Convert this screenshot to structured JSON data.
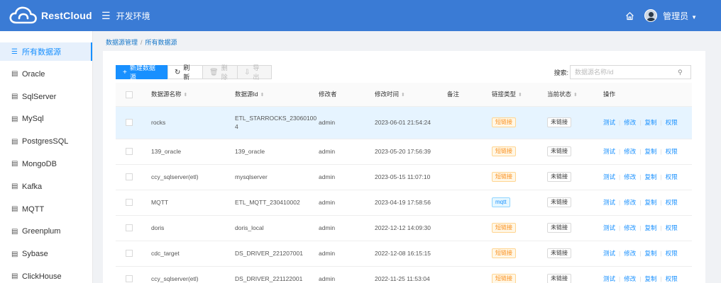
{
  "app": {
    "brand": "RestCloud",
    "environment": "开发环境",
    "user": "管理员"
  },
  "icons": {
    "menu": "menu-icon",
    "home": "home-icon",
    "list": "list-icon",
    "database": "database-icon",
    "search": "search-icon",
    "refresh": "refresh-icon",
    "delete": "trash-icon",
    "export": "export-icon",
    "add": "plus-icon"
  },
  "colors": {
    "header": "#3a7bd5",
    "primary": "#1890ff",
    "tag_short": "#fa8c16",
    "tag_mqtt": "#1890ff"
  },
  "sidebar": {
    "items": [
      {
        "label": "所有数据源",
        "active": true
      },
      {
        "label": "Oracle"
      },
      {
        "label": "SqlServer"
      },
      {
        "label": "MySql"
      },
      {
        "label": "PostgresSQL"
      },
      {
        "label": "MongoDB"
      },
      {
        "label": "Kafka"
      },
      {
        "label": "MQTT"
      },
      {
        "label": "Greenplum"
      },
      {
        "label": "Sybase"
      },
      {
        "label": "ClickHouse"
      }
    ]
  },
  "breadcrumb": {
    "parent": "数据源管理",
    "separator": "/",
    "current": "所有数据源"
  },
  "toolbar": {
    "new": "新建数据源",
    "refresh": "刷新",
    "delete": "删除",
    "export": "导出"
  },
  "search": {
    "label": "搜索:",
    "placeholder": "数据源名称/id"
  },
  "table": {
    "headers": {
      "name": "数据源名称",
      "id": "数据源Id",
      "modifier": "修改者",
      "time": "修改时间",
      "note": "备注",
      "link_type": "链接类型",
      "status": "当前状态",
      "ops": "操作"
    },
    "actions": [
      "测试",
      "修改",
      "复制",
      "权限"
    ],
    "rows": [
      {
        "name": "rocks",
        "id": "ETL_STARROCKS_23060100\n4",
        "modifier": "admin",
        "time": "2023-06-01 21:54:24",
        "note": "",
        "link_type": "短链接",
        "status": "未链接"
      },
      {
        "name": "139_oracle",
        "id": "139_oracle",
        "modifier": "admin",
        "time": "2023-05-20 17:56:39",
        "note": "",
        "link_type": "短链接",
        "status": "未链接"
      },
      {
        "name": "ccy_sqlserver(etl)",
        "id": "mysqlserver",
        "modifier": "admin",
        "time": "2023-05-15 11:07:10",
        "note": "",
        "link_type": "短链接",
        "status": "未链接"
      },
      {
        "name": "MQTT",
        "id": "ETL_MQTT_230410002",
        "modifier": "admin",
        "time": "2023-04-19 17:58:56",
        "note": "",
        "link_type": "mqtt",
        "status": "未链接"
      },
      {
        "name": "doris",
        "id": "doris_local",
        "modifier": "admin",
        "time": "2022-12-12 14:09:30",
        "note": "",
        "link_type": "短链接",
        "status": "未链接"
      },
      {
        "name": "cdc_target",
        "id": "DS_DRIVER_221207001",
        "modifier": "admin",
        "time": "2022-12-08 16:15:15",
        "note": "",
        "link_type": "短链接",
        "status": "未链接"
      },
      {
        "name": "ccy_sqlserver(etl)",
        "id": "DS_DRIVER_221122001",
        "modifier": "admin",
        "time": "2022-11-25 11:53:04",
        "note": "",
        "link_type": "短链接",
        "status": "未链接"
      }
    ]
  }
}
